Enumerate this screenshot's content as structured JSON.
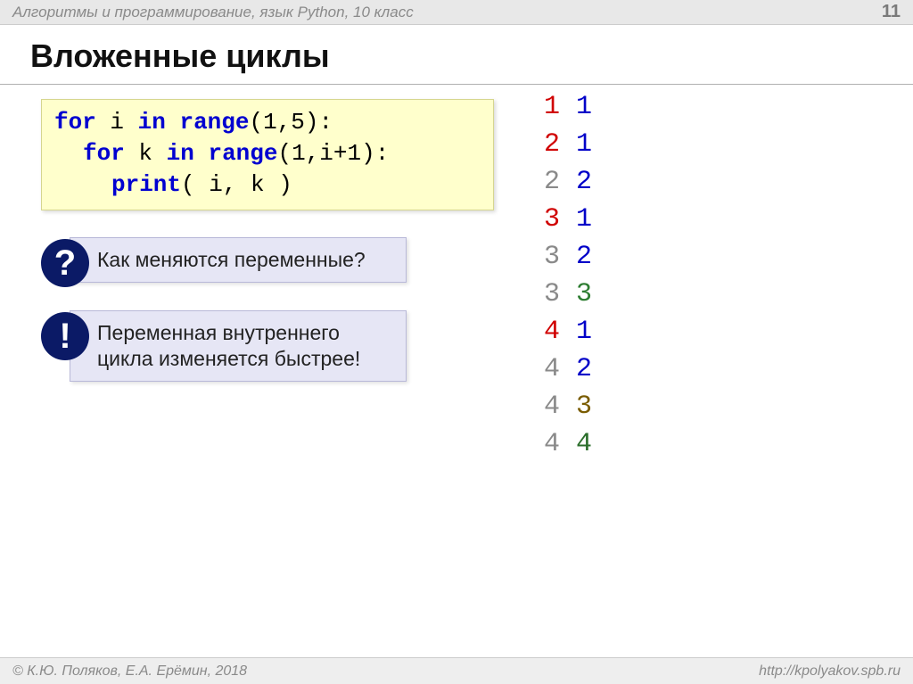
{
  "header": {
    "subject": "Алгоритмы и программирование, язык Python, 10 класс",
    "page_number": "11"
  },
  "title": "Вложенные циклы",
  "code": {
    "line1": {
      "for": "for",
      "var": "i",
      "in": "in",
      "fn": "range",
      "args": "(1,5):"
    },
    "line2": {
      "for": "for",
      "var": "k",
      "in": "in",
      "fn": "range",
      "args": "(1,i+1):"
    },
    "line3": {
      "fn": "print",
      "args": "( i, k )"
    }
  },
  "callouts": {
    "question": {
      "icon": "?",
      "text": "Как меняются переменные?"
    },
    "info": {
      "icon": "!",
      "text": "Переменная внутреннего цикла изменяется быстрее!"
    }
  },
  "output": [
    {
      "i": "1",
      "ic": "red",
      "k": "1",
      "kc": "blue"
    },
    {
      "i": "2",
      "ic": "red",
      "k": "1",
      "kc": "blue"
    },
    {
      "i": "2",
      "ic": "gray",
      "k": "2",
      "kc": "blue"
    },
    {
      "i": "3",
      "ic": "red",
      "k": "1",
      "kc": "blue"
    },
    {
      "i": "3",
      "ic": "gray",
      "k": "2",
      "kc": "blue"
    },
    {
      "i": "3",
      "ic": "gray",
      "k": "3",
      "kc": "green"
    },
    {
      "i": "4",
      "ic": "red",
      "k": "1",
      "kc": "blue"
    },
    {
      "i": "4",
      "ic": "gray",
      "k": "2",
      "kc": "blue"
    },
    {
      "i": "4",
      "ic": "gray",
      "k": "3",
      "kc": "brown"
    },
    {
      "i": "4",
      "ic": "gray",
      "k": "4",
      "kc": "dgreen"
    }
  ],
  "footer": {
    "copyright": "© К.Ю. Поляков, Е.А. Ерёмин, 2018",
    "url": "http://kpolyakov.spb.ru"
  }
}
